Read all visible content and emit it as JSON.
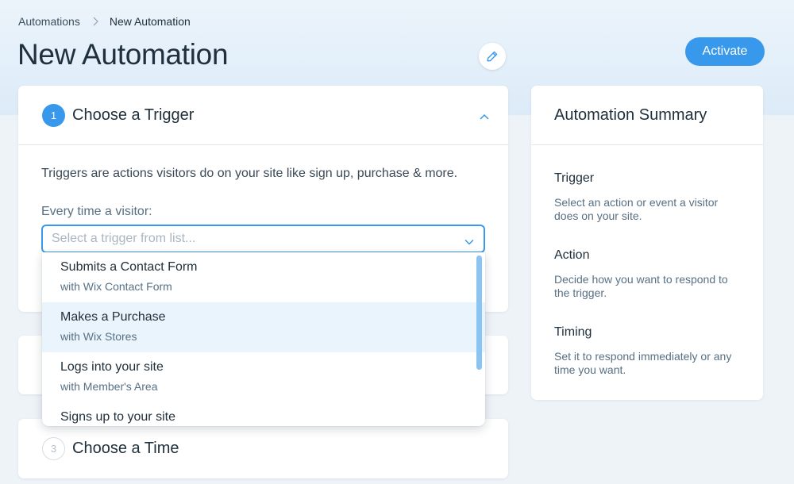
{
  "breadcrumb": {
    "parent": "Automations",
    "current": "New Automation"
  },
  "page": {
    "title": "New Automation",
    "edit_icon": "pencil-icon"
  },
  "actions": {
    "activate_label": "Activate"
  },
  "colors": {
    "accent": "#3899ec",
    "hover": "#eaf4fd",
    "header_bg": "#e4eff9"
  },
  "trigger_card": {
    "step": "1",
    "title": "Choose a Trigger",
    "description": "Triggers are actions visitors do on your site like sign up, purchase & more.",
    "field_label": "Every time a visitor:",
    "select_placeholder": "Select a trigger from list...",
    "options": [
      {
        "label": "Submits a Contact Form",
        "sub": "with Wix Contact Form",
        "highlighted": false
      },
      {
        "label": "Makes a Purchase",
        "sub": "with Wix Stores",
        "highlighted": true
      },
      {
        "label": "Logs into your site",
        "sub": "with Member's Area",
        "highlighted": false
      },
      {
        "label": "Signs up to your site",
        "sub": "",
        "highlighted": false
      }
    ],
    "scroll_position": 0.0
  },
  "time_card": {
    "step": "3",
    "title": "Choose a Time"
  },
  "summary": {
    "title": "Automation Summary",
    "sections": [
      {
        "heading": "Trigger",
        "text": "Select an action or event a visitor does on your site."
      },
      {
        "heading": "Action",
        "text": "Decide how you want to respond to the trigger."
      },
      {
        "heading": "Timing",
        "text": "Set it to respond immediately or any time you want."
      }
    ]
  }
}
